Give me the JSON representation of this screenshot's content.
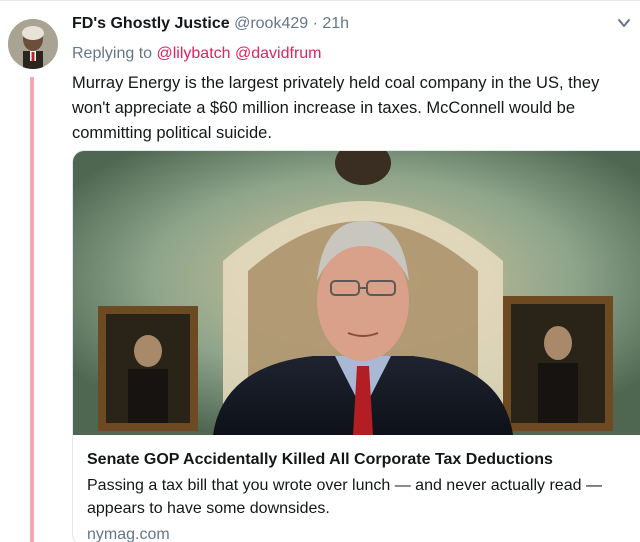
{
  "tweet": {
    "author_name": "FD's Ghostly Justice",
    "author_handle": "@rook429",
    "separator": "·",
    "timestamp": "21h",
    "replying_prefix": "Replying to",
    "replying_to": [
      "@lilybatch",
      "@davidfrum"
    ],
    "text": "Murray Energy is the largest privately held coal company in the US, they won't appreciate a $60 million increase in taxes. McConnell would be committing political  suicide."
  },
  "card": {
    "title": "Senate GOP Accidentally Killed All Corporate Tax Deductions",
    "description": "Passing a tax bill that you wrote over lunch — and never actually read — appears to have some downsides.",
    "domain": "nymag.com"
  },
  "colors": {
    "mention": "#e0245e",
    "secondary_text": "#657786",
    "thread_line": "#f4a6b4"
  },
  "icons": {
    "more_options": "chevron-down-icon"
  }
}
